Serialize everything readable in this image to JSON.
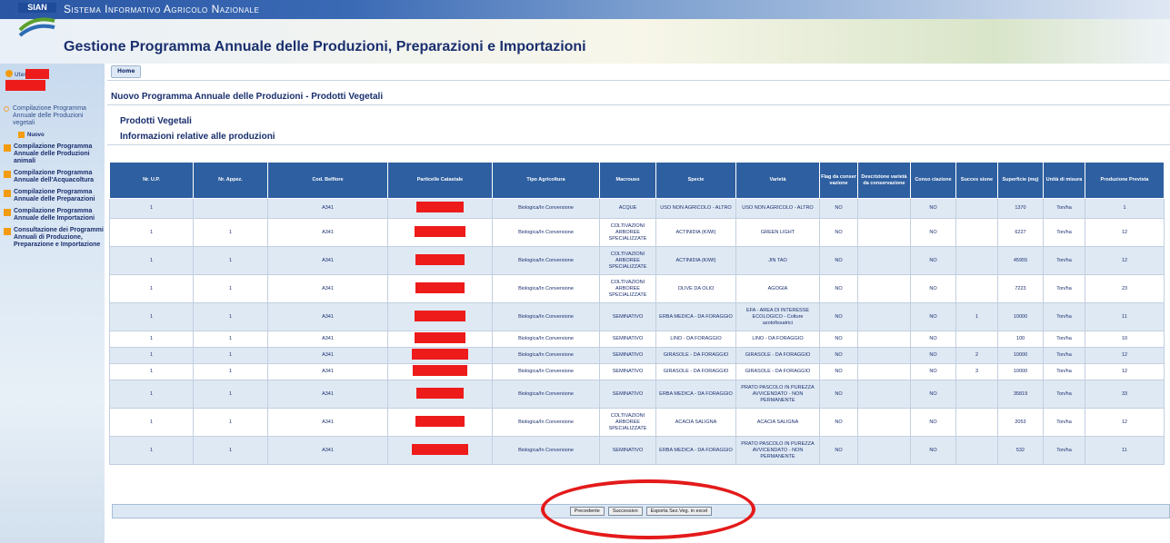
{
  "header": {
    "logo_text": "SIAN",
    "system_title": "Sistema Informativo Agricolo Nazionale",
    "app_title": "Gestione Programma Annuale delle Produzioni, Preparazioni e Importazioni"
  },
  "user": {
    "label": "Utente:"
  },
  "sidebar": {
    "items": [
      {
        "label": "Compilazione Programma Annuale delle Produzioni vegetali",
        "style": "normal"
      },
      {
        "label": "Compilazione Programma Annuale delle Produzioni animali",
        "style": "bold"
      },
      {
        "label": "Compilazione Programma Annuale dell'Acquacoltura",
        "style": "bold"
      },
      {
        "label": "Compilazione Programma Annuale delle Preparazioni",
        "style": "bold"
      },
      {
        "label": "Compilazione Programma Annuale delle Importazioni",
        "style": "bold"
      },
      {
        "label": "Consultazione dei Programmi Annuali di Produzione, Preparazione e Importazione",
        "style": "bold"
      }
    ],
    "sub_item": "Nuovo"
  },
  "main": {
    "home_tab": "Home",
    "page_heading": "Nuovo Programma Annuale delle Produzioni - Prodotti Vegetali",
    "section_title": "Prodotti Vegetali",
    "section_sub": "Informazioni relative alle produzioni"
  },
  "table": {
    "columns": [
      "Nr. U.P.",
      "Nr. Appez.",
      "Cod. Belfiore",
      "Particelle Catastale",
      "Tipo Agricoltura",
      "Macrouso",
      "Specie",
      "Varietà",
      "Flag da conser vazione",
      "Descrizione varietà da conservazione",
      "Conso ciazione",
      "Succes sione",
      "Superficie (mq)",
      "Unità di misura",
      "Produzione Prevista"
    ],
    "rows": [
      [
        "1",
        "",
        "A341",
        "",
        "Biologica/In Conversione",
        "ACQUE",
        "USO NON AGRICOLO - ALTRO",
        "USO NON AGRICOLO - ALTRO",
        "NO",
        "",
        "NO",
        "",
        "1370",
        "Ton/ha",
        "1"
      ],
      [
        "1",
        "1",
        "A341",
        "",
        "Biologica/In Conversione",
        "COLTIVAZIONI ARBOREE SPECIALIZZATE",
        "ACTINIDIA (KIWI)",
        "GREEN LIGHT",
        "NO",
        "",
        "NO",
        "",
        "6227",
        "Ton/ha",
        "12"
      ],
      [
        "1",
        "1",
        "A341",
        "",
        "Biologica/In Conversione",
        "COLTIVAZIONI ARBOREE SPECIALIZZATE",
        "ACTINIDIA (KIWI)",
        "JIN TAO",
        "NO",
        "",
        "NO",
        "",
        "45955",
        "Ton/ha",
        "12"
      ],
      [
        "1",
        "1",
        "A341",
        "",
        "Biologica/In Conversione",
        "COLTIVAZIONI ARBOREE SPECIALIZZATE",
        "OLIVE DA OLIO",
        "AGOGIA",
        "NO",
        "",
        "NO",
        "",
        "7223",
        "Ton/ha",
        "23"
      ],
      [
        "1",
        "1",
        "A341",
        "",
        "Biologica/In Conversione",
        "SEMINATIVO",
        "ERBA MEDICA - DA FORAGGIO",
        "EFA - AREA DI INTERESSE ECOLOGICO - Colture azotofissatrici",
        "NO",
        "",
        "NO",
        "1",
        "10000",
        "Ton/ha",
        "11"
      ],
      [
        "1",
        "1",
        "A341",
        "",
        "Biologica/In Conversione",
        "SEMINATIVO",
        "LINO - DA FORAGGIO",
        "LINO - DA FORAGGIO",
        "NO",
        "",
        "NO",
        "",
        "100",
        "Ton/ha",
        "10"
      ],
      [
        "1",
        "1",
        "A341",
        "",
        "Biologica/In Conversione",
        "SEMINATIVO",
        "GIRASOLE - DA FORAGGIO",
        "GIRASOLE - DA FORAGGIO",
        "NO",
        "",
        "NO",
        "2",
        "10000",
        "Ton/ha",
        "12"
      ],
      [
        "1",
        "1",
        "A341",
        "",
        "Biologica/In Conversione",
        "SEMINATIVO",
        "GIRASOLE - DA FORAGGIO",
        "GIRASOLE - DA FORAGGIO",
        "NO",
        "",
        "NO",
        "3",
        "10000",
        "Ton/ha",
        "12"
      ],
      [
        "1",
        "1",
        "A341",
        "",
        "Biologica/In Conversione",
        "SEMINATIVO",
        "ERBA MEDICA - DA FORAGGIO",
        "PRATO PASCOLO IN PUREZZA AVVICENDATO - NON PERMANENTE",
        "NO",
        "",
        "NO",
        "",
        "35819",
        "Ton/ha",
        "33"
      ],
      [
        "1",
        "1",
        "A341",
        "",
        "Biologica/In Conversione",
        "COLTIVAZIONI ARBOREE SPECIALIZZATE",
        "ACACIA SALIGNA",
        "ACACIA SALIGNA",
        "NO",
        "",
        "NO",
        "",
        "2053",
        "Ton/ha",
        "12"
      ],
      [
        "1",
        "1",
        "A341",
        "",
        "Biologica/In Conversione",
        "SEMINATIVO",
        "ERBA MEDICA - DA FORAGGIO",
        "PRATO PASCOLO IN PUREZZA AVVICENDATO - NON PERMANENTE",
        "NO",
        "",
        "NO",
        "",
        "532",
        "Ton/ha",
        "11"
      ]
    ]
  },
  "buttons": {
    "prev": "Precedente",
    "next": "Successivo",
    "export": "Esporta Sez.Veg. in excel"
  },
  "colors": {
    "header_blue": "#2e5fa0",
    "accent_orange": "#f39c12",
    "annotation_red": "#e41a1a"
  }
}
